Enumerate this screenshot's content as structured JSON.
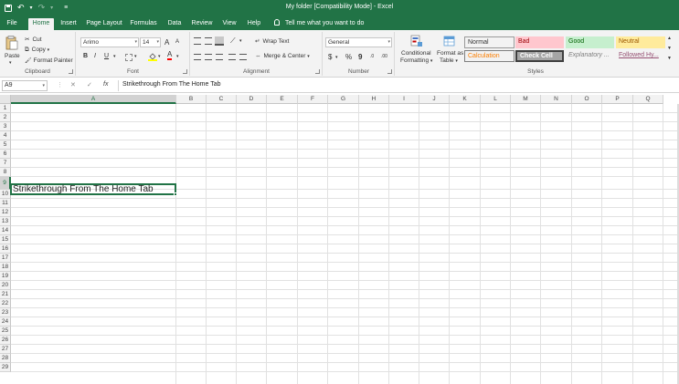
{
  "app": {
    "title": "My folder  [Compatibility Mode]  -  Excel"
  },
  "quick_access": {
    "save_icon": "save-icon",
    "undo_icon": "undo-icon",
    "redo_icon": "redo-icon",
    "customize_icon": "customize-icon",
    "undo_glyph": "↶",
    "redo_glyph": "↷",
    "dropdown_glyph": "▾",
    "customize_glyph": "≡"
  },
  "tabs": [
    {
      "label": "File"
    },
    {
      "label": "Home"
    },
    {
      "label": "Insert"
    },
    {
      "label": "Page Layout"
    },
    {
      "label": "Formulas"
    },
    {
      "label": "Data"
    },
    {
      "label": "Review"
    },
    {
      "label": "View"
    },
    {
      "label": "Help"
    }
  ],
  "tell_me": "Tell me what you want to do",
  "ribbon": {
    "clipboard": {
      "label": "Clipboard",
      "paste": "Paste",
      "cut": "Cut",
      "copy": "Copy",
      "format_painter": "Format Painter",
      "cut_glyph": "✂",
      "copy_glyph": "⧉",
      "brush_glyph": "🖌"
    },
    "font": {
      "label": "Font",
      "font_name": "Arimo",
      "font_size": "14",
      "grow": "A",
      "shrink": "A",
      "bold": "B",
      "italic": "I",
      "underline": "U",
      "font_color_letter": "A",
      "fill_color": "#ffff00",
      "font_color": "#ff0000"
    },
    "alignment": {
      "label": "Alignment",
      "wrap_text": "Wrap Text",
      "merge_center": "Merge & Center"
    },
    "number": {
      "label": "Number",
      "format": "General",
      "currency": "$",
      "percent": "%",
      "comma": "9",
      "increase_decimal": ".0",
      "decrease_decimal": ".00"
    },
    "styles": {
      "label": "Styles",
      "conditional": "Conditional",
      "formatting": "Formatting",
      "format_as": "Format as",
      "table": "Table",
      "cells": [
        {
          "label": "Normal",
          "bg": "#ffffff",
          "color": "#000000"
        },
        {
          "label": "Bad",
          "bg": "#ffc7ce",
          "color": "#9c0006"
        },
        {
          "label": "Good",
          "bg": "#c6efce",
          "color": "#006100"
        },
        {
          "label": "Neutral",
          "bg": "#ffeb9c",
          "color": "#9c5700"
        },
        {
          "label": "Calculation",
          "bg": "#f2f2f2",
          "color": "#fa7d00"
        },
        {
          "label": "Check Cell",
          "bg": "#a5a5a5",
          "color": "#ffffff"
        },
        {
          "label": "Explanatory ...",
          "bg": "#ffffff",
          "color": "#7f7f7f"
        },
        {
          "label": "Followed Hy...",
          "bg": "#ffffff",
          "color": "#954f72"
        }
      ]
    }
  },
  "formula_bar": {
    "name_box": "A9",
    "cancel": "✕",
    "enter": "✓",
    "fx": "fx",
    "content": "Strikethrough From The Home Tab"
  },
  "sheet": {
    "columns": [
      "A",
      "B",
      "C",
      "D",
      "E",
      "F",
      "G",
      "H",
      "I",
      "J",
      "K",
      "L",
      "M",
      "N",
      "O",
      "P",
      "Q"
    ],
    "rows": [
      "1",
      "2",
      "3",
      "4",
      "5",
      "6",
      "7",
      "8",
      "9",
      "10",
      "11",
      "12",
      "13",
      "14",
      "15",
      "16",
      "17",
      "18",
      "19",
      "20",
      "21",
      "22",
      "23",
      "24",
      "25",
      "26",
      "27",
      "28",
      "29"
    ],
    "selected_column": "A",
    "selected_row": "9",
    "cell_a9": "Strikethrough From The Home Tab"
  }
}
